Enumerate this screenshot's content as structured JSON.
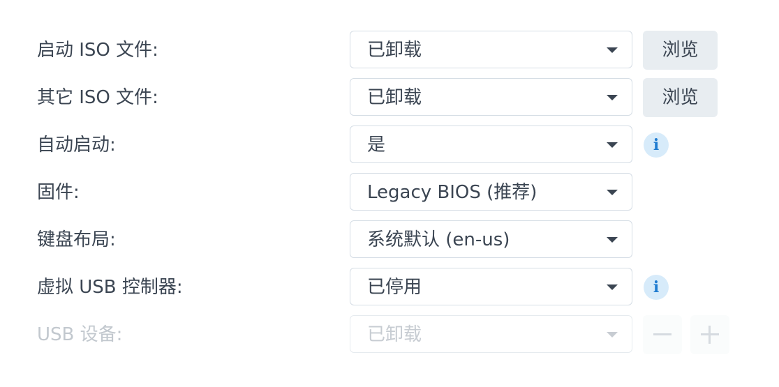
{
  "rows": [
    {
      "label": "启动 ISO 文件:",
      "value": "已卸载",
      "browse": "浏览"
    },
    {
      "label": "其它 ISO 文件:",
      "value": "已卸载",
      "browse": "浏览"
    },
    {
      "label": "自动启动:",
      "value": "是",
      "info": "i"
    },
    {
      "label": "固件:",
      "value": "Legacy BIOS (推荐)"
    },
    {
      "label": "键盘布局:",
      "value": "系统默认 (en-us)"
    },
    {
      "label": "虚拟 USB 控制器:",
      "value": "已停用",
      "info": "i"
    },
    {
      "label": "USB 设备:",
      "value": "已卸载",
      "disabled": true
    }
  ],
  "usb_buttons": {
    "remove_icon": "minus-icon",
    "add_icon": "plus-icon"
  },
  "colors": {
    "text": "#3b4552",
    "info_bg": "#d7ebfa",
    "info_fg": "#1e7bd0",
    "button_bg": "#e8edf1"
  }
}
